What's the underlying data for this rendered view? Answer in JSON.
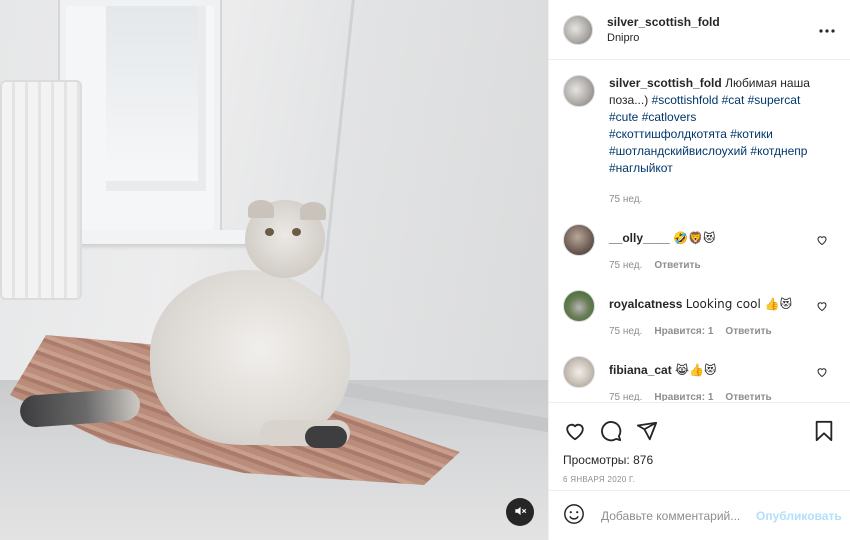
{
  "post": {
    "username": "silver_scottish_fold",
    "location": "Dnipro",
    "caption_text": "Любимая наша поза...)",
    "hashtags": "#scottishfold #cat #supercat #cute #catlovers #скоттишфолдкотята #котики #шотландскийвислоухий #котднепр #наглыйкот",
    "caption_time": "75 нед."
  },
  "comments": [
    {
      "user": "__olly____",
      "text": "🤣🦁😻",
      "time": "75 нед.",
      "likes": "",
      "reply": "Ответить"
    },
    {
      "user": "royalcatness",
      "text": "Looking cool 👍😻",
      "time": "75 нед.",
      "likes": "Нравится: 1",
      "reply": "Ответить"
    },
    {
      "user": "fibiana_cat",
      "text": "😹👍😻",
      "time": "75 нед.",
      "likes": "Нравится: 1",
      "reply": "Ответить"
    }
  ],
  "stats": {
    "views": "Просмотры: 876",
    "date": "6 января 2020 г."
  },
  "composer": {
    "placeholder": "Добавьте комментарий...",
    "publish": "Опубликовать"
  },
  "icons": {
    "more": "more-horizontal-icon",
    "like": "heart-outline-icon",
    "comment": "comment-bubble-icon",
    "share": "paper-plane-icon",
    "save": "bookmark-outline-icon",
    "emoji": "smiley-icon",
    "mute": "speaker-muted-icon"
  },
  "colors": {
    "link": "#00376b",
    "muted": "#8e8e8e",
    "publish_disabled": "#b2dffc"
  }
}
